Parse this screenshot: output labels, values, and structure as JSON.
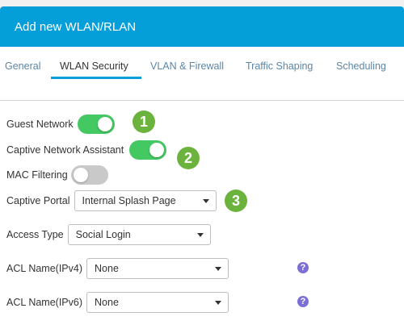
{
  "dialog": {
    "title": "Add new WLAN/RLAN"
  },
  "tabs": [
    {
      "label": "General"
    },
    {
      "label": "WLAN Security"
    },
    {
      "label": "VLAN & Firewall"
    },
    {
      "label": "Traffic Shaping"
    },
    {
      "label": "Scheduling"
    }
  ],
  "form": {
    "guest_network": {
      "label": "Guest Network",
      "enabled": true
    },
    "captive_network_assistant": {
      "label": "Captive Network Assistant",
      "enabled": true
    },
    "mac_filtering": {
      "label": "MAC Filtering",
      "enabled": false
    },
    "captive_portal": {
      "label": "Captive Portal",
      "value": "Internal Splash Page"
    },
    "access_type": {
      "label": "Access Type",
      "value": "Social Login"
    },
    "acl_ipv4": {
      "label": "ACL Name(IPv4)",
      "value": "None"
    },
    "acl_ipv6": {
      "label": "ACL Name(IPv6)",
      "value": "None"
    }
  },
  "callouts": [
    "1",
    "2",
    "3"
  ],
  "help_glyph": "?",
  "colors": {
    "header": "#049fd9",
    "toggle_on": "#44c862",
    "toggle_off": "#c9c9c9",
    "callout": "#6cb33e",
    "help": "#7b6fd6"
  }
}
